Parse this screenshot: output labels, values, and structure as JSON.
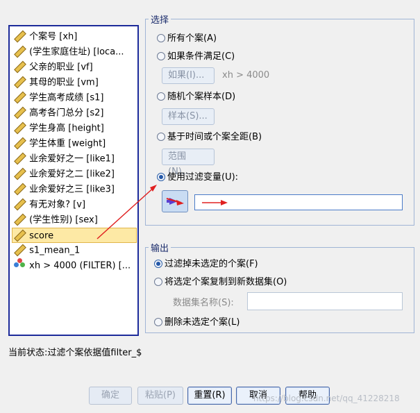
{
  "variables": [
    {
      "label": "个案号 [xh]",
      "icon": "ruler-icon"
    },
    {
      "label": "(学生家庭住址) [loca...",
      "icon": "ruler-icon"
    },
    {
      "label": "父亲的职业 [vf]",
      "icon": "ruler-icon"
    },
    {
      "label": "其母的职业 [vm]",
      "icon": "ruler-icon"
    },
    {
      "label": "学生高考成绩 [s1]",
      "icon": "ruler-icon"
    },
    {
      "label": "高考各门总分 [s2]",
      "icon": "ruler-icon"
    },
    {
      "label": "学生身高 [height]",
      "icon": "ruler-icon"
    },
    {
      "label": "学生体重 [weight]",
      "icon": "ruler-icon"
    },
    {
      "label": "业余爱好之一 [like1]",
      "icon": "ruler-icon"
    },
    {
      "label": "业余爱好之二 [like2]",
      "icon": "ruler-icon"
    },
    {
      "label": "业余爱好之三 [like3]",
      "icon": "ruler-icon"
    },
    {
      "label": "有无对象? [v]",
      "icon": "ruler-icon"
    },
    {
      "label": "(学生性别) [sex]",
      "icon": "ruler-icon"
    },
    {
      "label": "score",
      "icon": "ruler-icon",
      "selected": true
    },
    {
      "label": "s1_mean_1",
      "icon": "ruler-icon"
    },
    {
      "label": "xh > 4000 (FILTER) [...",
      "icon": "nominal-filter-icon"
    }
  ],
  "select": {
    "title": "选择",
    "all_cases": "所有个案(A)",
    "if_condition": "如果条件满足(C)",
    "if_button": "如果(I)...",
    "if_expression": "xh > 4000",
    "random_sample": "随机个案样本(D)",
    "sample_button": "样本(S)...",
    "time_range": "基于时间或个案全距(B)",
    "range_button": "范围(N)...",
    "use_filter": "使用过滤变量(U):",
    "filter_value": ""
  },
  "output": {
    "title": "输出",
    "filter_out": "过滤掉未选定的个案(F)",
    "copy_to_dataset": "将选定个案复制到新数据集(O)",
    "dataset_name_label": "数据集名称(S):",
    "dataset_name_value": "",
    "delete_unselected": "删除未选定个案(L)"
  },
  "status": "当前状态:过滤个案依据值filter_$",
  "buttons": {
    "ok": "确定",
    "paste": "粘贴(P)",
    "reset": "重置(R)",
    "cancel": "取消",
    "help": "帮助"
  },
  "watermark": "https://blog.csdn.net/qq_41228218",
  "colors": {
    "accent": "#1c2a9a",
    "arrow": "#e02020",
    "selection": "#fde9a5"
  }
}
